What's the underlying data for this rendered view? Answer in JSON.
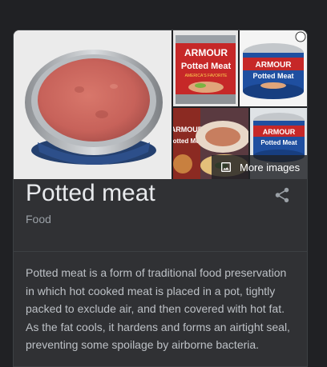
{
  "panel": {
    "title": "Potted meat",
    "subtitle": "Food",
    "more_images_label": "More images",
    "description": "Potted meat is a form of traditional food preservation in which hot cooked meat is placed in a pot, tightly packed to exclude air, and then covered with hot fat. As the fat cools, it hardens and forms an airtight seal, preventing some spoilage by airborne bacteria."
  },
  "product_labels": {
    "brand": "ARMOUR",
    "product": "Potted Meat",
    "tagline": "AMERICA'S FAVORITE"
  },
  "colors": {
    "background": "#202124",
    "card": "#303134",
    "title_text": "#e8eaed",
    "secondary_text": "#9aa0a6",
    "body_text": "#bdc1c6",
    "brand_red": "#c62828",
    "brand_blue": "#1f4fa0"
  },
  "icons": {
    "more_images": "image-icon",
    "share": "share-icon"
  }
}
